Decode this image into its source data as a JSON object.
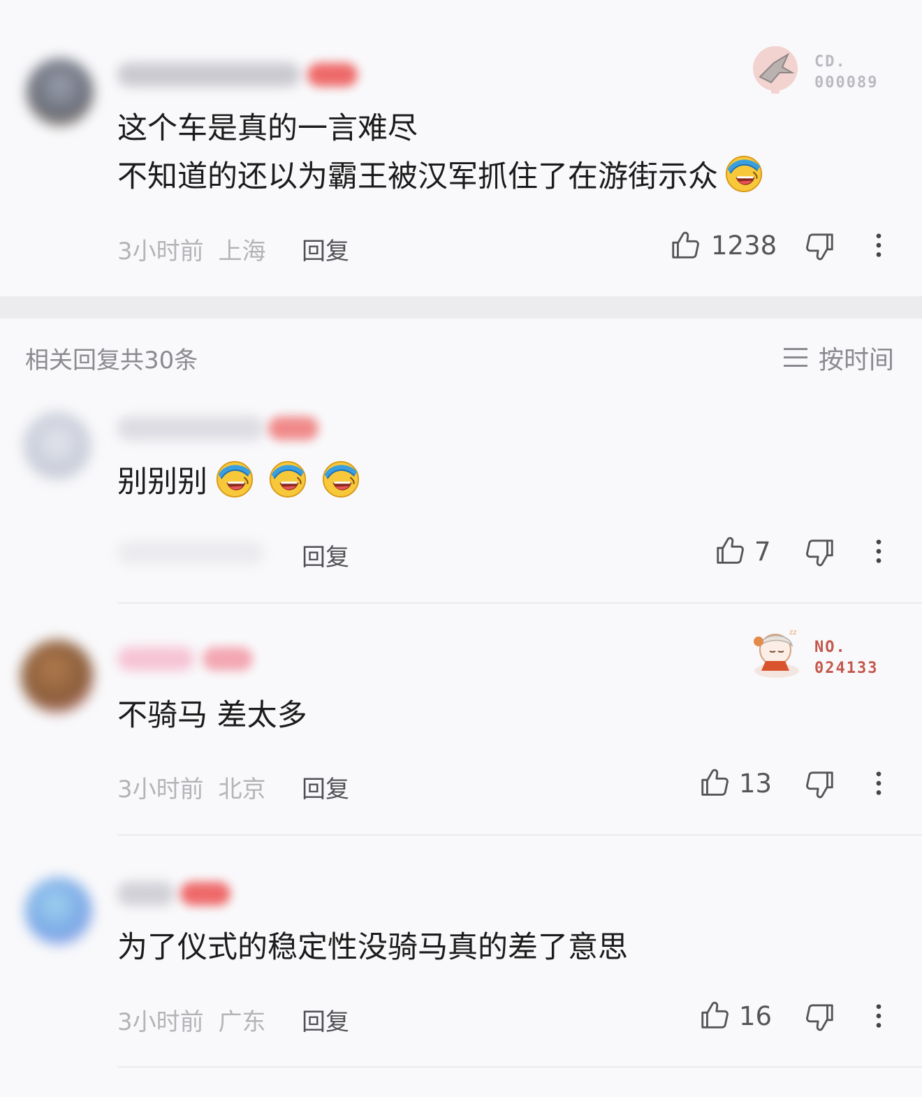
{
  "top_comment": {
    "badge": {
      "line1": "CD.",
      "line2": "000089"
    },
    "content_line1": "这个车是真的一言难尽",
    "content_line2": "不知道的还以为霸王被汉军抓住了在游街示众",
    "time": "3小时前",
    "location": "上海",
    "reply_label": "回复",
    "likes": "1238"
  },
  "replies_header": {
    "count_label": "相关回复共30条",
    "sort_label": "按时间"
  },
  "replies": [
    {
      "content": "别别别",
      "reply_label": "回复",
      "likes": "7"
    },
    {
      "badge": {
        "line1": "NO.",
        "line2": "024133"
      },
      "content": "不骑马 差太多",
      "time": "3小时前",
      "location": "北京",
      "reply_label": "回复",
      "likes": "13"
    },
    {
      "content": "为了仪式的稳定性没骑马真的差了意思",
      "time": "3小时前",
      "location": "广东",
      "reply_label": "回复",
      "likes": "16"
    }
  ],
  "icons": {
    "like": "thumbs-up-icon",
    "dislike": "thumbs-down-icon",
    "more": "more-vertical-icon",
    "sort": "sort-lines-icon",
    "emoji": "laughing-crying-emoji"
  },
  "colors": {
    "background": "#f9f9fb",
    "badge_gray": "#b9b9c0",
    "badge_red": "#c4574c",
    "emoji_yellow": "#f7c83a",
    "emoji_blue": "#3a9fe0"
  }
}
